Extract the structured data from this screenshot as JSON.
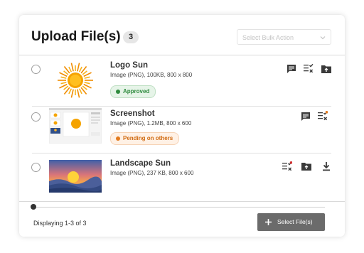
{
  "header": {
    "title": "Upload File(s)",
    "count": "3"
  },
  "bulk_action": {
    "placeholder": "Select Bulk Action"
  },
  "files": [
    {
      "name": "Logo Sun",
      "meta": "Image (PNG), 100KB, 800 x 800",
      "status": "Approved",
      "status_color": "#2e8b3e"
    },
    {
      "name": "Screenshot",
      "meta": "Image (PNG), 1.2MB, 800 x 600",
      "status": "Pending on others",
      "status_color": "#e47a1c"
    },
    {
      "name": "Landscape Sun",
      "meta": "Image (PNG), 237 KB, 800 x 600"
    }
  ],
  "footer": {
    "displaying": "Displaying 1-3 of 3",
    "select_files_label": "Select File(s)"
  },
  "colors": {
    "accent_button": "#6b6b6b",
    "approved": "#2e8b3e",
    "pending": "#e47a1c",
    "alert_dot": "#d32f2f"
  },
  "icons": [
    "comment-icon",
    "checklist-icon",
    "folder-upload-icon",
    "download-icon",
    "chevron-down-icon",
    "plus-icon"
  ]
}
